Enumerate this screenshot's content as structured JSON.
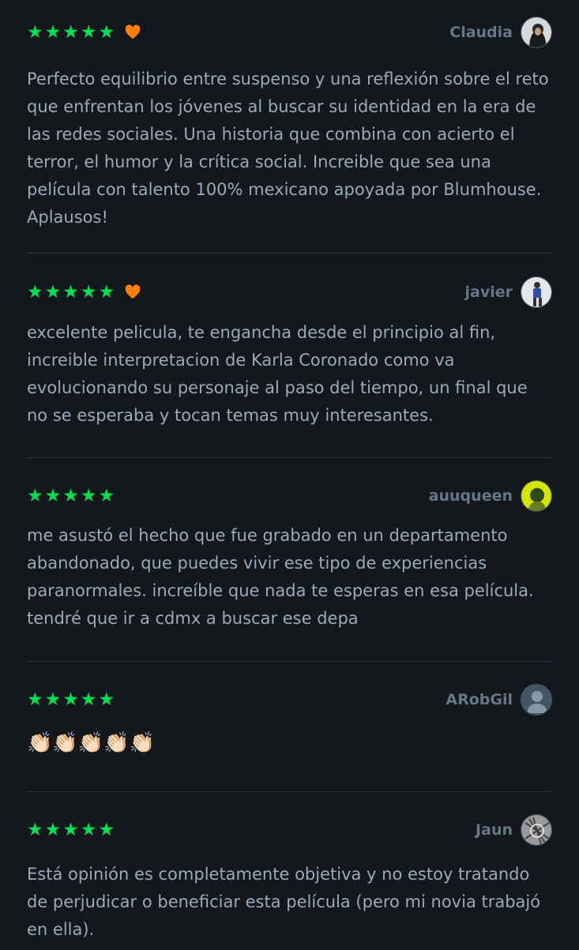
{
  "colors": {
    "background": "#14181c",
    "star": "#00e054",
    "heart": "#ff8000",
    "text": "#99aabb",
    "author": "#667788",
    "divider": "#2c3440"
  },
  "reviews": [
    {
      "stars": "★★★★★",
      "liked": true,
      "author": "Claudia",
      "avatar_icon": "user-photo-dark",
      "text": "Perfecto equilibrio entre suspenso y una reflexión sobre el reto que enfrentan los jóvenes al buscar su identidad en la era de las redes sociales. Una historia que combina con acierto el terror, el humor y la crítica social. Increible que sea una película con talento 100% mexicano apoyada por Blumhouse. Aplausos!"
    },
    {
      "stars": "★★★★★",
      "liked": true,
      "author": "javier",
      "avatar_icon": "user-photo-runner",
      "text": "excelente pelicula, te engancha desde el principio al fin, increible interpretacion de Karla Coronado como va evolucionando su personaje al paso del tiempo, un final que no se esperaba y tocan temas muy interesantes."
    },
    {
      "stars": "★★★★★",
      "liked": false,
      "author": "auuqueen",
      "avatar_icon": "user-photo-yellow",
      "text": "me asustó el hecho que fue grabado en un departamento abandonado, que puedes vivir ese tipo de experiencias paranormales. increíble que nada te esperas en esa película. tendré que ir a cdmx a buscar ese depa"
    },
    {
      "stars": "★★★★★",
      "liked": false,
      "author": "ARobGil",
      "avatar_icon": "default-user-icon",
      "text": "👏🏻👏🏻👏🏻👏🏻👏🏻"
    },
    {
      "stars": "★★★★★",
      "liked": false,
      "author": "Jaun",
      "avatar_icon": "user-photo-sketch",
      "text": "Está opinión es completamente objetiva y no estoy tratando de perjudicar o beneficiar esta película (pero mi novia trabajó en ella)."
    }
  ]
}
